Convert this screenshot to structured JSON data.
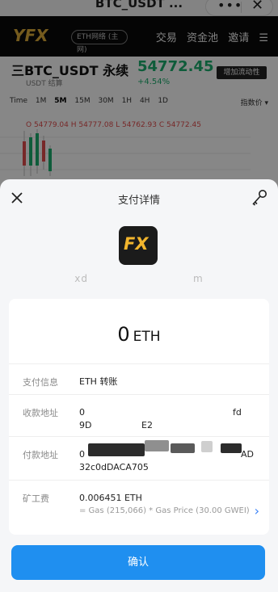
{
  "browser": {
    "title": "BTC_USDT ...",
    "more_icon": "more-dots-icon",
    "close_icon": "close-icon"
  },
  "background_page": {
    "logo": "YFX",
    "network": "ETH网络 (主网)",
    "nav_links": [
      "交易",
      "资金池",
      "邀请"
    ],
    "pair": "三BTC_USDT 永续",
    "pair_sub": "USDT 结算",
    "price": "54772.45",
    "change": "+4.54%",
    "add_button": "增加流动性",
    "timeframes": [
      "Time",
      "1M",
      "5M",
      "15M",
      "30M",
      "1H",
      "4H",
      "1D"
    ],
    "active_timeframe": "5M",
    "indicator": "指数价 ▾",
    "ohlc": "O 54779.04  H 54777.08  L 54762.93  C 54772.45"
  },
  "sheet": {
    "title": "支付详情",
    "dapp_logo_text": "FX",
    "dapp_url_start": "xd",
    "dapp_url_end": "m",
    "amount_value": "0",
    "amount_unit": "ETH",
    "rows": {
      "payment_info": {
        "label": "支付信息",
        "value": "ETH 转账"
      },
      "to_address": {
        "label": "收款地址",
        "line1_start": "0",
        "line1_end": "fd",
        "line2_start": "9D",
        "line2_end": "E2"
      },
      "from_address": {
        "label": "付款地址",
        "line1_start": "0",
        "line1_end": "AD",
        "line2": "32c0dDACA705"
      },
      "fee": {
        "label": "矿工费",
        "value": "0.006451 ETH",
        "detail": "= Gas (215,066) * Gas Price (30.00 GWEI)"
      }
    },
    "confirm_label": "确认"
  },
  "colors": {
    "accent": "#1f8ff0",
    "chevron": "#3a82f7",
    "logo_gold": "#f2b52d",
    "price_green": "#1aa86a"
  }
}
